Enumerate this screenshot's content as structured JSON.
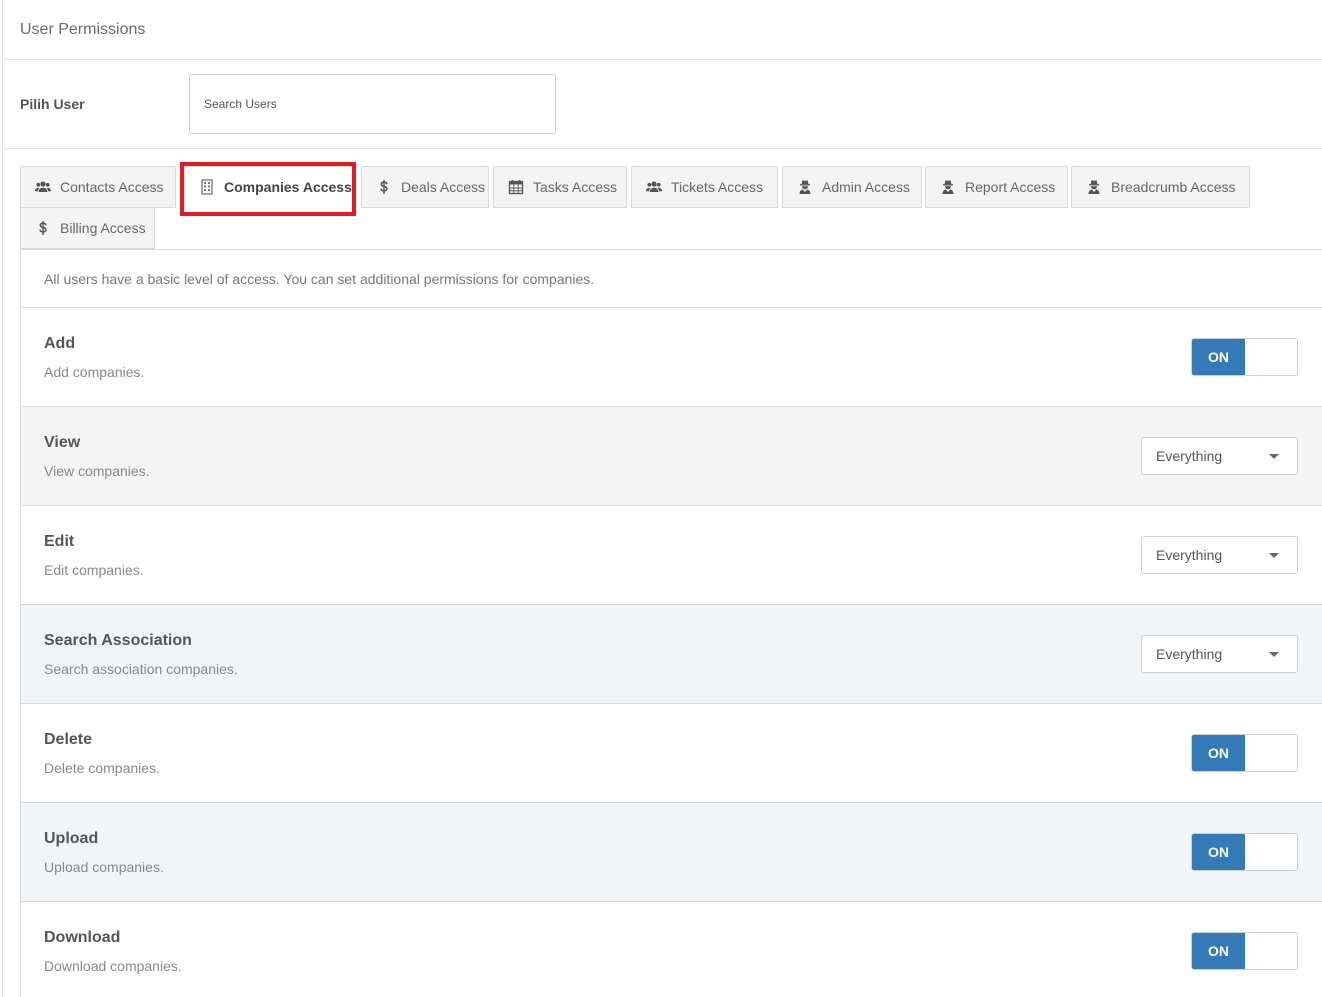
{
  "header": {
    "title": "User Permissions"
  },
  "user_select": {
    "label": "Pilih User",
    "placeholder": "Search Users"
  },
  "tabs": [
    {
      "label": "Contacts Access",
      "icon": "users-icon"
    },
    {
      "label": "Companies Access",
      "icon": "building-icon",
      "active": true
    },
    {
      "label": "Deals Access",
      "icon": "dollar-icon"
    },
    {
      "label": "Tasks Access",
      "icon": "calendar-icon"
    },
    {
      "label": "Tickets Access",
      "icon": "users-icon"
    },
    {
      "label": "Admin Access",
      "icon": "user-secret-icon"
    },
    {
      "label": "Report Access",
      "icon": "user-secret-icon"
    },
    {
      "label": "Breadcrumb Access",
      "icon": "user-secret-icon"
    },
    {
      "label": "Billing Access",
      "icon": "dollar-icon"
    }
  ],
  "intro": "All users have a basic level of access. You can set additional permissions for companies.",
  "permissions": [
    {
      "title": "Add",
      "desc": "Add companies.",
      "control": "toggle",
      "value": "ON"
    },
    {
      "title": "View",
      "desc": "View companies.",
      "control": "select",
      "value": "Everything"
    },
    {
      "title": "Edit",
      "desc": "Edit companies.",
      "control": "select",
      "value": "Everything"
    },
    {
      "title": "Search Association",
      "desc": "Search association companies.",
      "control": "select",
      "value": "Everything"
    },
    {
      "title": "Delete",
      "desc": "Delete companies.",
      "control": "toggle",
      "value": "ON"
    },
    {
      "title": "Upload",
      "desc": "Upload companies.",
      "control": "toggle",
      "value": "ON"
    },
    {
      "title": "Download",
      "desc": "Download companies.",
      "control": "toggle",
      "value": "ON"
    }
  ],
  "colors": {
    "toggle_on": "#337ab7",
    "highlight": "#e01b24"
  }
}
